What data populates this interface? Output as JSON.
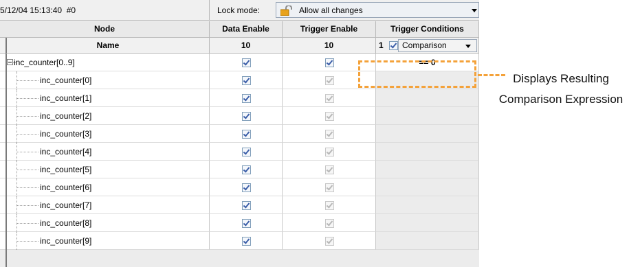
{
  "toolbar": {
    "timestamp": "5/12/04 15:13:40  #0",
    "lock_mode_label": "Lock mode:",
    "lock_mode_value": "Allow all changes"
  },
  "columns": {
    "node": "Node",
    "data_enable": "Data Enable",
    "trigger_enable": "Trigger Enable",
    "trigger_conditions": "Trigger Conditions"
  },
  "subheader": {
    "name": "Name",
    "data_enable_count": "10",
    "trigger_enable_count": "10",
    "trigger_index": "1",
    "trigger_type": "Comparison"
  },
  "rows": [
    {
      "name": "inc_counter[0..9]",
      "condition": "== 0"
    },
    {
      "name": "inc_counter[0]"
    },
    {
      "name": "inc_counter[1]"
    },
    {
      "name": "inc_counter[2]"
    },
    {
      "name": "inc_counter[3]"
    },
    {
      "name": "inc_counter[4]"
    },
    {
      "name": "inc_counter[5]"
    },
    {
      "name": "inc_counter[6]"
    },
    {
      "name": "inc_counter[7]"
    },
    {
      "name": "inc_counter[8]"
    },
    {
      "name": "inc_counter[9]"
    }
  ],
  "annotation": {
    "line1": "Displays Resulting",
    "line2": "Comparison Expression",
    "color": "#f4a23a"
  }
}
